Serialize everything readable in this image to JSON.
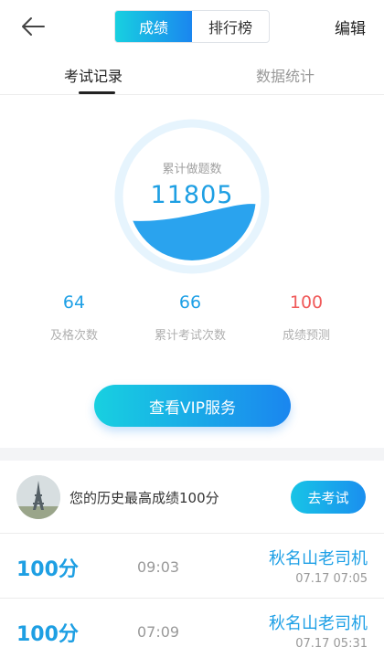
{
  "header": {
    "segments": [
      "成绩",
      "排行榜"
    ],
    "active_segment": "成绩",
    "edit_label": "编辑",
    "back_icon": "arrow-left-icon"
  },
  "tabs": [
    {
      "label": "考试记录",
      "active": true
    },
    {
      "label": "数据统计",
      "active": false
    }
  ],
  "progress_ring": {
    "label": "累计做题数",
    "value": "11805",
    "fill_fraction": 0.38,
    "color": "#2aa3ee"
  },
  "stats": [
    {
      "value": "64",
      "label": "及格次数",
      "color": "#1ea0e6"
    },
    {
      "value": "66",
      "label": "累计考试次数",
      "color": "#1ea0e6"
    },
    {
      "value": "100",
      "label": "成绩预测",
      "color": "#f05a5a"
    }
  ],
  "vip_button_label": "查看VIP服务",
  "best": {
    "text": "您的历史最高成绩100分",
    "button_label": "去考试"
  },
  "records": [
    {
      "score": "100分",
      "duration": "09:03",
      "name": "秋名山老司机",
      "datetime": "07.17  07:05"
    },
    {
      "score": "100分",
      "duration": "07:09",
      "name": "秋名山老司机",
      "datetime": "07.17  05:31"
    }
  ]
}
